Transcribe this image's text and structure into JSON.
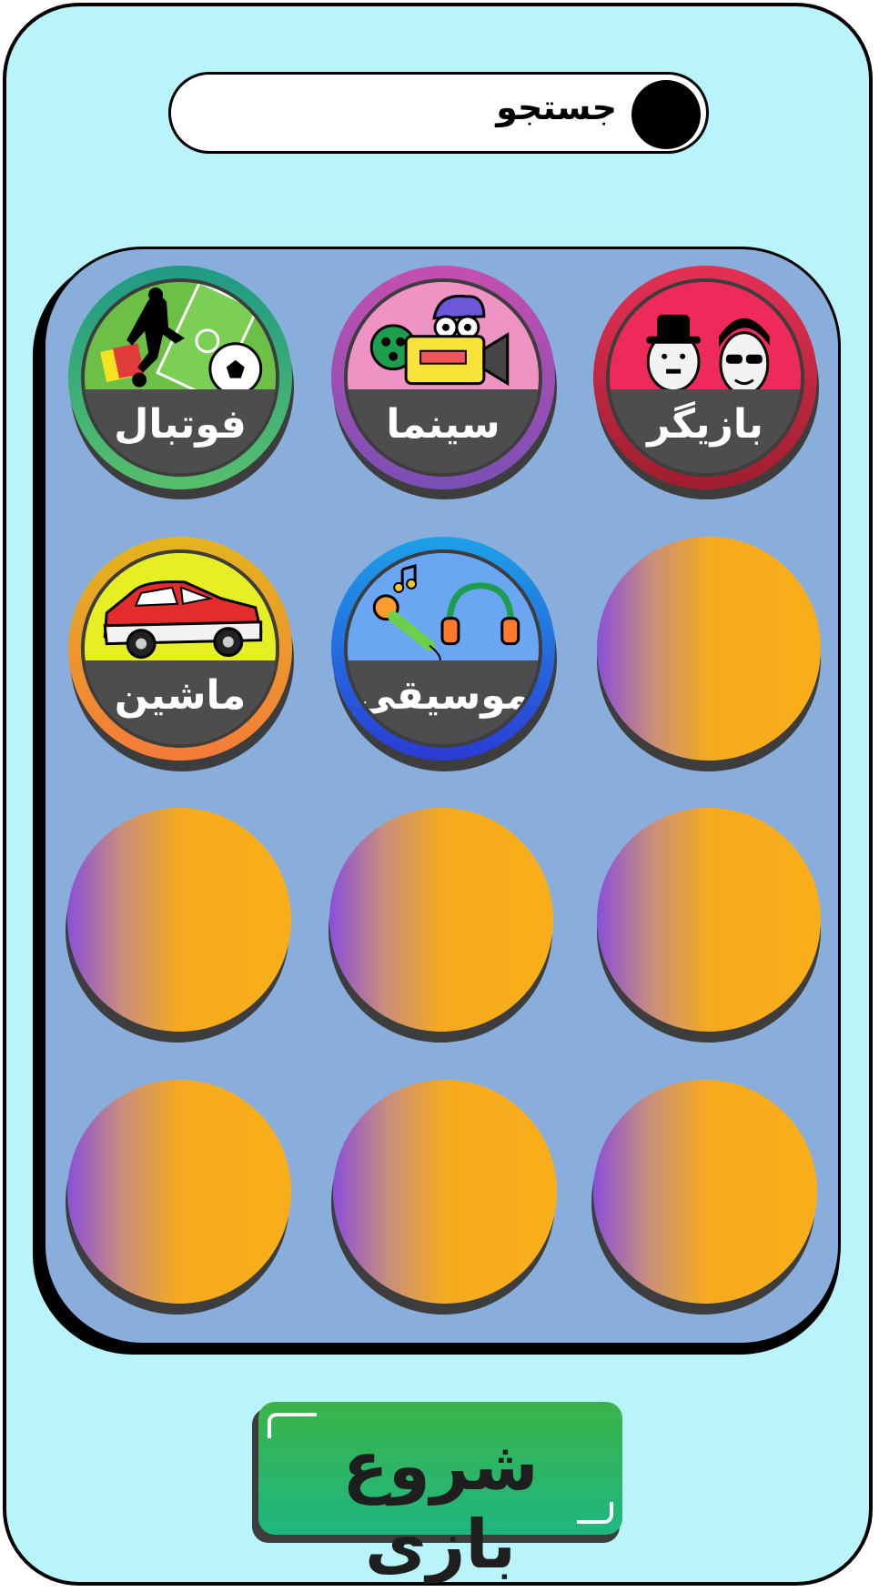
{
  "search": {
    "label": "جستجو"
  },
  "categories": [
    {
      "label": "بازیگر",
      "top_color": "#ee2a5a",
      "ring": "#c62a3d",
      "icon": "actors-faces-icon"
    },
    {
      "label": "سینما",
      "top_color": "#ee93c4",
      "ring": "#b04fb3",
      "icon": "movie-camera-icon"
    },
    {
      "label": "فوتبال",
      "top_color": "#6cc046",
      "ring": "#3cab74",
      "icon": "football-icon"
    },
    {
      "label": "موسیقی",
      "top_color": "#6aa6f2",
      "ring": "#1e63df",
      "icon": "music-icon"
    },
    {
      "label": "ماشین",
      "top_color": "#e6ef23",
      "ring": "#f09a2c",
      "icon": "car-icon"
    }
  ],
  "empty_slots": 7,
  "start_button": {
    "label": "شروع بازی"
  },
  "colors": {
    "background": "#b8f4f9",
    "panel": "#8aaedc",
    "empty_slot_orange": "#f9ae19",
    "empty_slot_purple": "#8a4fd9",
    "start_green": "#3bb34a"
  }
}
